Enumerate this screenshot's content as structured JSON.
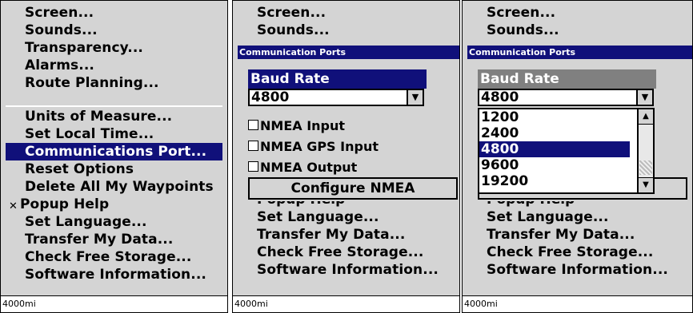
{
  "panel1": {
    "menu_top": [
      "Screen...",
      "Sounds...",
      "Transparency...",
      "Alarms...",
      "Route Planning..."
    ],
    "menu_bottom": [
      "Units of Measure...",
      "Set Local Time...",
      "Communications Port...",
      "Reset Options",
      "Delete All My Waypoints",
      "Popup Help",
      "Set Language...",
      "Transfer My Data...",
      "Check Free Storage...",
      "Software Information..."
    ],
    "popup_help_checked": true,
    "selected_item": "Communications Port...",
    "scale": "4000mi"
  },
  "panel2": {
    "menu_top": [
      "Screen...",
      "Sounds..."
    ],
    "dialog_title": "Communication Ports",
    "baud_label": "Baud Rate",
    "baud_value": "4800",
    "options": [
      "NMEA Input",
      "NMEA GPS Input",
      "NMEA Output"
    ],
    "configure_button": "Configure NMEA",
    "cut_item": "Popup Help",
    "menu_bottom": [
      "Set Language...",
      "Transfer My Data...",
      "Check Free Storage...",
      "Software Information..."
    ],
    "scale": "4000mi"
  },
  "panel3": {
    "menu_top": [
      "Screen...",
      "Sounds..."
    ],
    "dialog_title": "Communication Ports",
    "baud_label": "Baud Rate",
    "baud_value": "4800",
    "baud_options": [
      "1200",
      "2400",
      "4800",
      "9600",
      "19200"
    ],
    "selected_baud": "4800",
    "cut_item": "Popup Help",
    "menu_bottom": [
      "Set Language...",
      "Transfer My Data...",
      "Check Free Storage...",
      "Software Information..."
    ],
    "scale": "4000mi"
  },
  "icons": {
    "dropdown": "chevron-down-icon",
    "checkbox": "checkbox-icon",
    "scroll_up": "scroll-up-icon",
    "scroll_down": "scroll-down-icon"
  },
  "colors": {
    "selection": "#10107a",
    "panel_bg": "#d4d4d4",
    "disabled_label": "#808080"
  }
}
